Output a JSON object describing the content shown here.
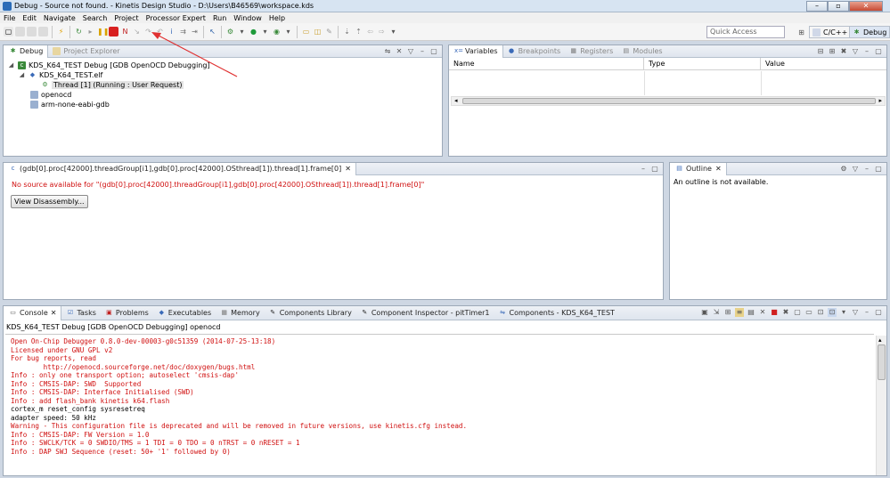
{
  "window": {
    "title": "Debug - Source not found. - Kinetis Design Studio - D:\\Users\\B46569\\workspace.kds"
  },
  "menu": [
    "File",
    "Edit",
    "Navigate",
    "Search",
    "Project",
    "Processor Expert",
    "Run",
    "Window",
    "Help"
  ],
  "toolbar": {
    "quick_access_placeholder": "Quick Access",
    "perspective_cc": "C/C++",
    "perspective_debug": "Debug"
  },
  "debug_view": {
    "tabs": [
      "Debug",
      "Project Explorer"
    ],
    "tree": [
      "KDS_K64_TEST Debug [GDB OpenOCD Debugging]",
      "KDS_K64_TEST.elf",
      "Thread [1] (Running : User Request)",
      "openocd",
      "arm-none-eabi-gdb"
    ]
  },
  "variables_view": {
    "tabs": [
      "Variables",
      "Breakpoints",
      "Registers",
      "Modules"
    ],
    "columns": [
      "Name",
      "Type",
      "Value"
    ]
  },
  "editor": {
    "tab": "(gdb[0].proc[42000].threadGroup[i1],gdb[0].proc[42000].OSthread[1]).thread[1].frame[0]",
    "message": "No source available for \"(gdb[0].proc[42000].threadGroup[i1],gdb[0].proc[42000].OSthread[1]).thread[1].frame[0]\"",
    "button": "View Disassembly..."
  },
  "outline": {
    "tab": "Outline",
    "message": "An outline is not available."
  },
  "bottom_tabs": [
    "Console",
    "Tasks",
    "Problems",
    "Executables",
    "Memory",
    "Components Library",
    "Component Inspector - pitTimer1",
    "Components - KDS_K64_TEST"
  ],
  "console": {
    "header": "KDS_K64_TEST Debug [GDB OpenOCD Debugging] openocd",
    "lines": [
      {
        "text": "Open On-Chip Debugger 0.8.0-dev-00003-g0c51359 (2014-07-25-13:18)",
        "color": "red"
      },
      {
        "text": "Licensed under GNU GPL v2",
        "color": "red"
      },
      {
        "text": "For bug reports, read",
        "color": "red"
      },
      {
        "text": "        http://openocd.sourceforge.net/doc/doxygen/bugs.html",
        "color": "red"
      },
      {
        "text": "Info : only one transport option; autoselect 'cmsis-dap'",
        "color": "red"
      },
      {
        "text": "Info : CMSIS-DAP: SWD  Supported",
        "color": "red"
      },
      {
        "text": "Info : CMSIS-DAP: Interface Initialised (SWD)",
        "color": "red"
      },
      {
        "text": "Info : add flash_bank kinetis k64.flash",
        "color": "red"
      },
      {
        "text": "cortex_m reset_config sysresetreq",
        "color": "black"
      },
      {
        "text": "adapter speed: 50 kHz",
        "color": "black"
      },
      {
        "text": "Warning - This configuration file is deprecated and will be removed in future versions, use kinetis.cfg instead.",
        "color": "red"
      },
      {
        "text": "Info : CMSIS-DAP: FW Version = 1.0",
        "color": "red"
      },
      {
        "text": "Info : SWCLK/TCK = 0 SWDIO/TMS = 1 TDI = 0 TDO = 0 nTRST = 0 nRESET = 1",
        "color": "red"
      },
      {
        "text": "Info : DAP SWJ Sequence (reset: 50+ '1' followed by 0)",
        "color": "red"
      }
    ]
  },
  "colors": {
    "annotation_arrow": "#e03030",
    "error_text": "#d01010"
  }
}
